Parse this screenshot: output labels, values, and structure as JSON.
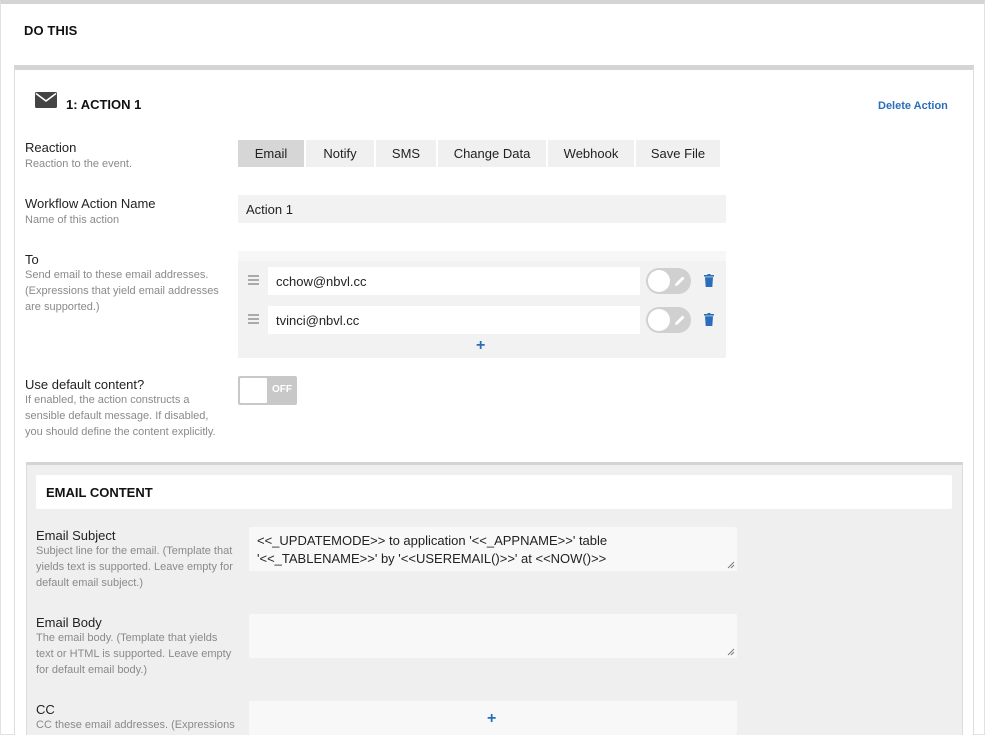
{
  "section": {
    "title": "DO THIS"
  },
  "action": {
    "title": "1: ACTION 1",
    "delete_label": "Delete Action",
    "icon": "envelope-icon"
  },
  "reaction": {
    "label": "Reaction",
    "help": "Reaction to the event.",
    "options": [
      "Email",
      "Notify",
      "SMS",
      "Change Data",
      "Webhook",
      "Save File"
    ],
    "selected": "Email"
  },
  "action_name": {
    "label": "Workflow Action Name",
    "help": "Name of this action",
    "value": "Action 1"
  },
  "to": {
    "label": "To",
    "help": "Send email to these email addresses. (Expressions that yield email addresses are supported.)",
    "emails": [
      "cchow@nbvl.cc",
      "tvinci@nbvl.cc"
    ],
    "add_label": "+"
  },
  "default_content": {
    "label": "Use default content?",
    "help": "If enabled, the action constructs a sensible default message. If disabled, you should define the content explicitly.",
    "toggle_text": "OFF"
  },
  "email_content": {
    "title": "EMAIL CONTENT",
    "subject": {
      "label": "Email Subject",
      "help": "Subject line for the email. (Template that yields text is supported. Leave empty for default email subject.)",
      "value": "<<_UPDATEMODE>> to application '<<_APPNAME>>' table '<<_TABLENAME>>' by '<<USEREMAIL()>>' at <<NOW()>>"
    },
    "body": {
      "label": "Email Body",
      "help": "The email body. (Template that yields text or HTML is supported. Leave empty for default email body.)",
      "value": ""
    },
    "cc": {
      "label": "CC",
      "help": "CC these email addresses. (Expressions",
      "add_label": "+"
    }
  },
  "colors": {
    "accent": "#2a6ebb",
    "selected_segment": "#d6d6d6"
  }
}
